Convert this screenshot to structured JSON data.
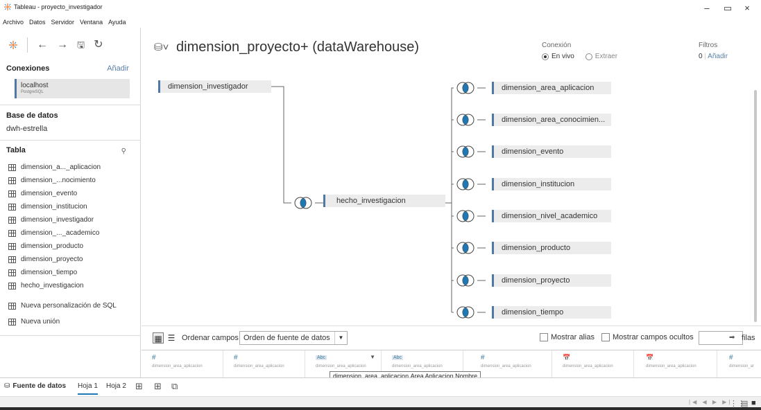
{
  "window": {
    "title": "Tableau - proyecto_investigador",
    "controls": {
      "minimize": "–",
      "maximize": "▭",
      "close": "×"
    }
  },
  "menu": [
    "Archivo",
    "Datos",
    "Servidor",
    "Ventana",
    "Ayuda"
  ],
  "left": {
    "connections_title": "Conexiones",
    "add_link": "Añadir",
    "connection": {
      "name": "localhost",
      "type": "PostgreSQL"
    },
    "database_title": "Base de datos",
    "database": "dwh-estrella",
    "table_title": "Tabla",
    "tables": [
      "dimension_a..._aplicacion",
      "dimension_...nocimiento",
      "dimension_evento",
      "dimension_institucion",
      "dimension_investigador",
      "dimension_..._academico",
      "dimension_producto",
      "dimension_proyecto",
      "dimension_tiempo",
      "hecho_investigacion"
    ],
    "extras": [
      "Nueva personalización de SQL",
      "Nueva unión"
    ]
  },
  "canvas": {
    "title": "dimension_proyecto+ (dataWarehouse)",
    "connection_label": "Conexión",
    "live": "En vivo",
    "extract": "Extraer",
    "filters_label": "Filtros",
    "filters_count": "0",
    "filters_add": "Añadir",
    "left_table": "dimension_investigador",
    "fact_table": "hecho_investigacion",
    "right_tables": [
      "dimension_area_aplicacion",
      "dimension_area_conocimien...",
      "dimension_evento",
      "dimension_institucion",
      "dimension_nivel_academico",
      "dimension_producto",
      "dimension_proyecto",
      "dimension_tiempo"
    ]
  },
  "grid_toolbar": {
    "sort_label": "Ordenar campos",
    "sort_value": "Orden de fuente de datos",
    "show_alias": "Mostrar alias",
    "show_hidden": "Mostrar campos ocultos",
    "rows_label": "filas"
  },
  "fields": [
    {
      "type": "#",
      "source": "dimension_area_aplicacion"
    },
    {
      "type": "#",
      "source": "dimension_area_aplicacion"
    },
    {
      "type": "Abc",
      "source": "dimension_area_aplicacion"
    },
    {
      "type": "Abc",
      "source": "dimension_area_aplicacion"
    },
    {
      "type": "#",
      "source": "dimension_area_aplicacion"
    },
    {
      "type": "📅",
      "source": "dimension_area_aplicacion"
    },
    {
      "type": "📅",
      "source": "dimension_area_aplicacion"
    },
    {
      "type": "#",
      "source": "dimension_ar"
    }
  ],
  "tooltip": "dimension_area_aplicacion.Area Aplicacion Nombre",
  "sheets": {
    "datasource": "Fuente de datos",
    "sheet1": "Hoja 1",
    "sheet2": "Hoja 2"
  },
  "colors": {
    "accent": "#4e79a7",
    "link": "#5b7fa7",
    "join_blue": "#1f77b4"
  }
}
